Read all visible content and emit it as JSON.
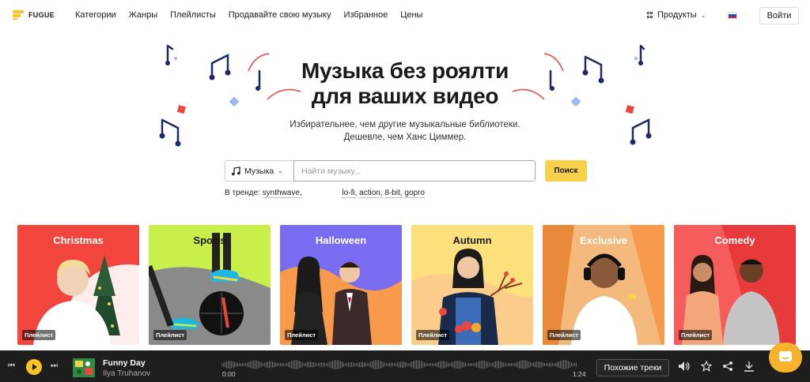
{
  "header": {
    "logo_text": "FUGUE",
    "nav": [
      "Категории",
      "Жанры",
      "Плейлисты",
      "Продавайте свою музыку",
      "Избранное",
      "Цены"
    ],
    "products_label": "Продукты",
    "login_label": "Войти"
  },
  "hero": {
    "title_line1": "Музыка без роялти",
    "title_line2": "для ваших видео",
    "subtitle_line1": "Избирательнее, чем другие музыкальные библиотеки.",
    "subtitle_line2": "Дешевле, чем Ханс Циммер."
  },
  "search": {
    "type_label": "Музыка",
    "placeholder": "Найти музыку...",
    "button_label": "Поиск",
    "trend_label": "В тренде:",
    "trend_tags": [
      "synthwave,",
      "lo-fi,",
      "action,",
      "8-bit,",
      "gopro"
    ]
  },
  "cards": [
    {
      "title": "Christmas",
      "badge": "Плейлист",
      "color": "#f2453d"
    },
    {
      "title": "Sports",
      "badge": "Плейлист",
      "color": "#c9f04a"
    },
    {
      "title": "Halloween",
      "badge": "Плейлист",
      "color": "#7a6cf0"
    },
    {
      "title": "Autumn",
      "badge": "Плейлист",
      "color": "#fbe07c"
    },
    {
      "title": "Exclusive",
      "badge": "Плейлист",
      "color": "#f79a4c"
    },
    {
      "title": "Comedy",
      "badge": "Плейлист",
      "color": "#f65c5c"
    }
  ],
  "player": {
    "track": "Funny Day",
    "artist": "Ilya Truhanov",
    "time_start": "0:00",
    "time_end": "1:24",
    "similar_label": "Похожие треки",
    "progress": 0
  },
  "colors": {
    "accent": "#f7d149",
    "player_bg": "#1e1e1e",
    "note_navy": "#1c2a6b"
  }
}
